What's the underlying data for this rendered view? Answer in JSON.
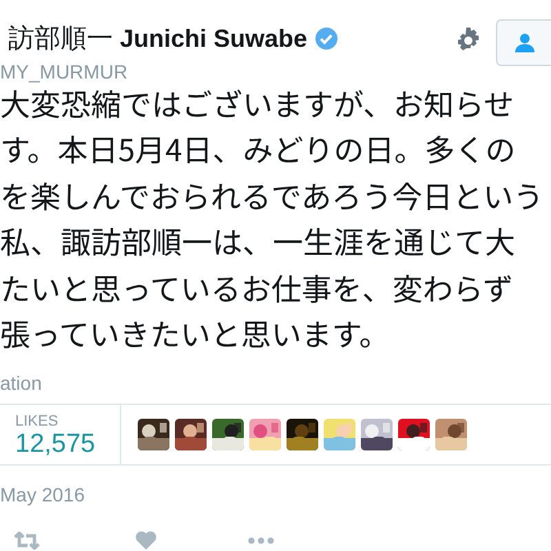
{
  "header": {
    "name_jp": "訪部順一",
    "name": "Junichi Suwabe",
    "verified": true,
    "handle": "MY_MURMUR"
  },
  "tweet": {
    "lines": [
      "大変恐縮ではございますが、お知らせ",
      "す。本日5月4日、みどりの日。多くの",
      "を楽しんでおられるであろう今日という",
      "私、諏訪部順一は、一生涯を通じて大",
      "たいと思っているお仕事を、変わらず",
      "張っていきたいと思います。"
    ],
    "translate_link": "ation"
  },
  "stats": {
    "label": "LIKES",
    "count": "12,575"
  },
  "date": "May 2016"
}
